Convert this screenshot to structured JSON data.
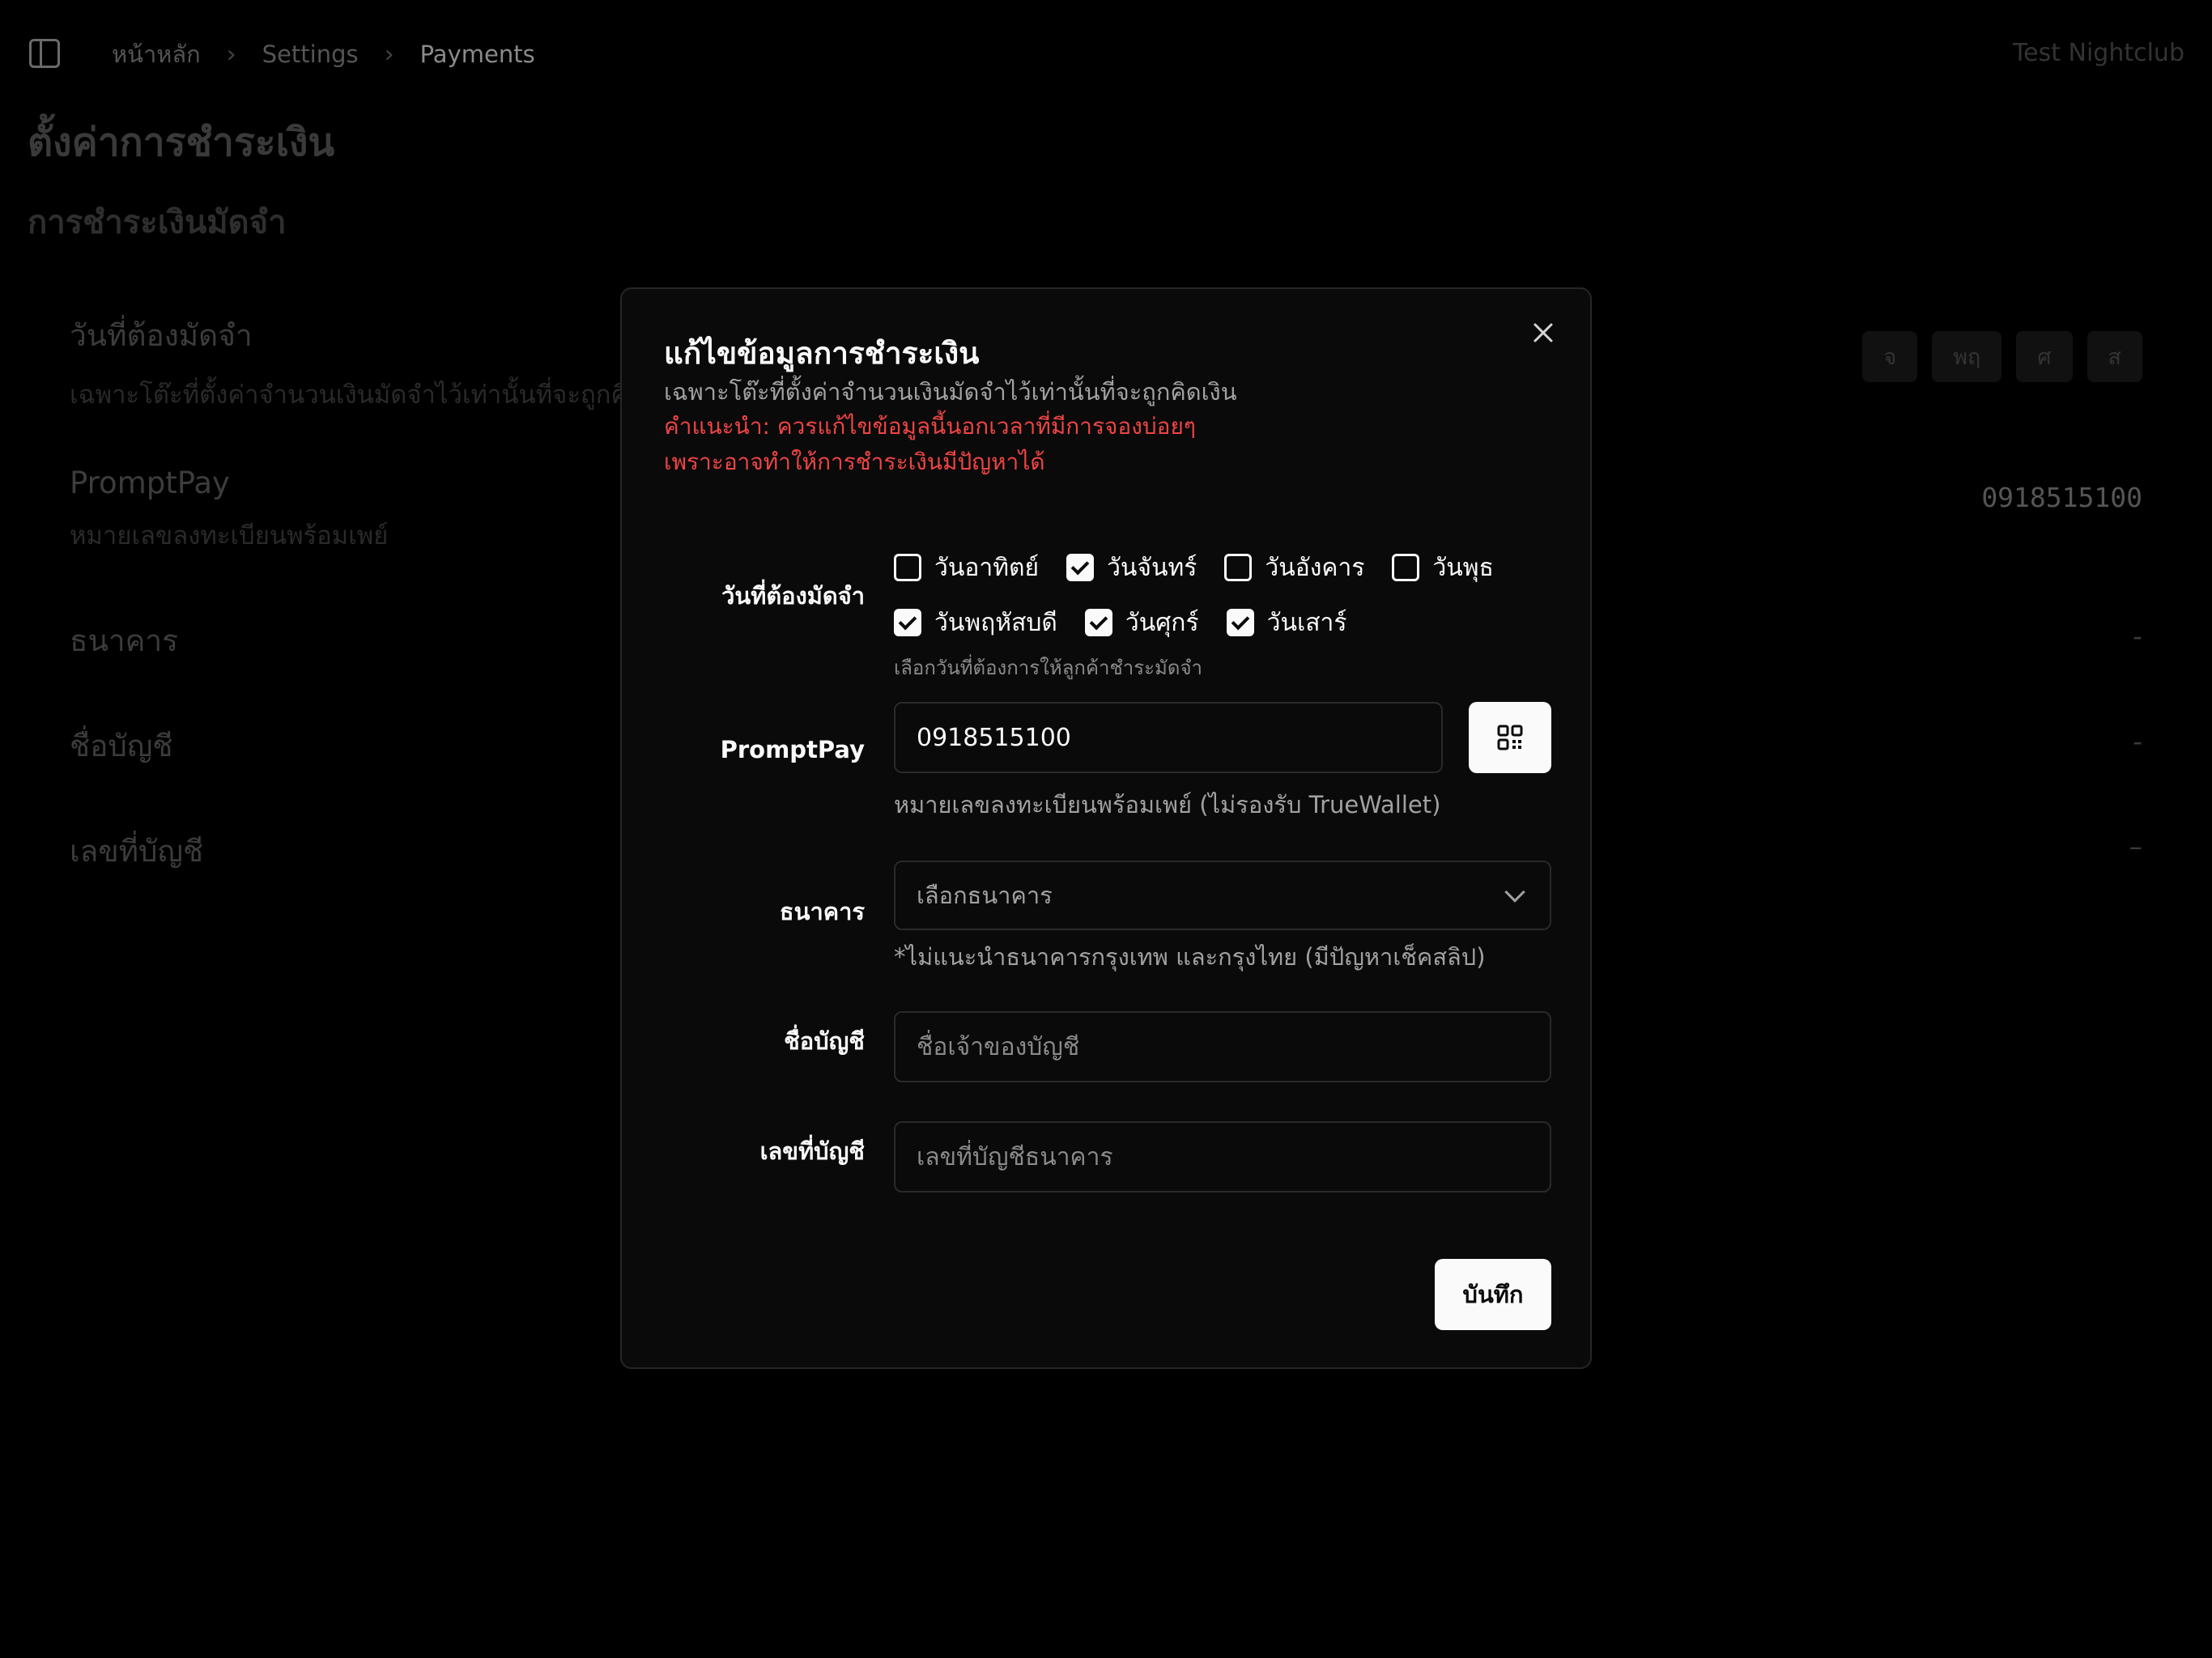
{
  "breadcrumb": {
    "home": "หน้าหลัก",
    "settings": "Settings",
    "current": "Payments"
  },
  "org_name": "Test Nightclub",
  "page_title": "ตั้งค่าการชำระเงิน",
  "section_title": "การชำระเงินมัดจำ",
  "background_rows": {
    "deposit_days": {
      "label": "วันที่ต้องมัดจำ",
      "desc": "เฉพาะโต๊ะที่ตั้งค่าจำนวนเงินมัดจำไว้เท่านั้นที่จะถูกคิ",
      "day_pills": [
        "จ",
        "พฤ",
        "ศ",
        "ส"
      ]
    },
    "promptpay": {
      "label": "PromptPay",
      "desc": "หมายเลขลงทะเบียนพร้อมเพย์",
      "value": "0918515100"
    },
    "bank": {
      "label": "ธนาคาร",
      "value": "-"
    },
    "account_name": {
      "label": "ชื่อบัญชี",
      "value": "-"
    },
    "account_number": {
      "label": "เลขที่บัญชี",
      "value": "–"
    }
  },
  "modal": {
    "title": "แก้ไขข้อมูลการชำระเงิน",
    "description": "เฉพาะโต๊ะที่ตั้งค่าจำนวนเงินมัดจำไว้เท่านั้นที่จะถูกคิดเงิน",
    "warning_line1": "คำแนะนำ: ควรแก้ไขข้อมูลนี้นอกเวลาที่มีการจองบ่อยๆ",
    "warning_line2": "เพราะอาจทำให้การชำระเงินมีปัญหาได้",
    "deposit_days": {
      "label": "วันที่ต้องมัดจำ",
      "days": [
        {
          "name": "วันอาทิตย์",
          "checked": false
        },
        {
          "name": "วันจันทร์",
          "checked": true
        },
        {
          "name": "วันอังคาร",
          "checked": false
        },
        {
          "name": "วันพุธ",
          "checked": false
        },
        {
          "name": "วันพฤหัสบดี",
          "checked": true
        },
        {
          "name": "วันศุกร์",
          "checked": true
        },
        {
          "name": "วันเสาร์",
          "checked": true
        }
      ],
      "hint": "เลือกวันที่ต้องการให้ลูกค้าชำระมัดจำ"
    },
    "promptpay": {
      "label": "PromptPay",
      "value": "0918515100",
      "hint": "หมายเลขลงทะเบียนพร้อมเพย์ (ไม่รองรับ TrueWallet)",
      "qr_icon": "qr-code-icon"
    },
    "bank": {
      "label": "ธนาคาร",
      "placeholder": "เลือกธนาคาร",
      "hint": "*ไม่แนะนำธนาคารกรุงเทพ และกรุงไทย (มีปัญหาเช็คสลิป)"
    },
    "account_name": {
      "label": "ชื่อบัญชี",
      "placeholder": "ชื่อเจ้าของบัญชี"
    },
    "account_number": {
      "label": "เลขที่บัญชี",
      "placeholder": "เลขที่บัญชีธนาคาร"
    },
    "save_label": "บันทึก",
    "close_icon": "close-icon"
  },
  "colors": {
    "background": "#000000",
    "modal": "#0a0a0a",
    "warning": "#ef4444",
    "primary": "#fafafa"
  }
}
